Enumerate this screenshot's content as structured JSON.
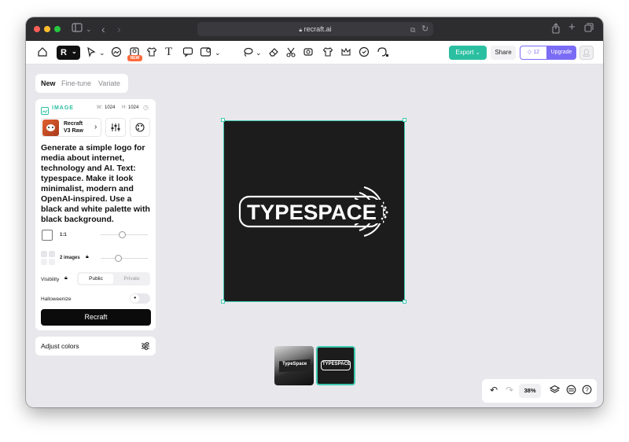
{
  "browser": {
    "url": "recraft.ai",
    "dots": [
      "#ff5f57",
      "#febc2e",
      "#28c840"
    ]
  },
  "toolbar": {
    "logo_letter": "R",
    "new_badge": "NEW",
    "export_label": "Export",
    "share_label": "Share",
    "credits": "12",
    "upgrade_label": "Upgrade"
  },
  "mode_tabs": [
    "New",
    "Fine-tune",
    "Variate"
  ],
  "panel": {
    "section_label": "IMAGE",
    "width_label": "W:",
    "width_value": "1024",
    "height_label": "H:",
    "height_value": "1024",
    "model_name": "Recraft",
    "model_version": "V3 Raw",
    "prompt": "Generate a simple logo for media about internet, technology and AI. Text: typespace. Make it look minimalist, modern and OpenAI-inspired. Use a black and white palette with black background.",
    "ratio_label": "1:1",
    "ratio_slider": 0.45,
    "images_label": "2 images",
    "images_slider": 0.35,
    "visibility_label": "Visibility",
    "visibility_options": [
      "Public",
      "Private"
    ],
    "visibility_selected": "Public",
    "halloweenize_label": "Halloweenize",
    "recraft_button": "Recraft"
  },
  "adjust_colors_label": "Adjust colors",
  "canvas": {
    "logo_text": "TYPESPACE"
  },
  "thumbnails": {
    "thumb1_text": "TypeSpace",
    "thumb2_text": "TYPESPACE"
  },
  "zoom": {
    "value": "38%"
  },
  "colors": {
    "accent": "#2bbfa1",
    "upgrade": "#7b6cf6",
    "canvas_bg": "#1c1c1c",
    "workspace_bg": "#e8e8ec"
  }
}
